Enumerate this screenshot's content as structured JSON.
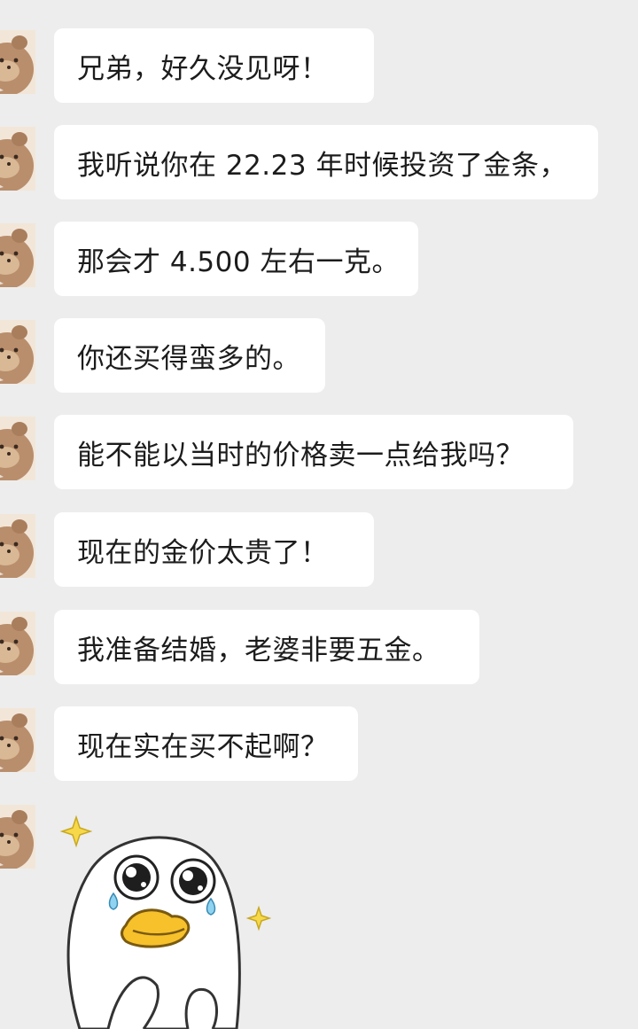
{
  "chat": {
    "messages": [
      {
        "text": "兄弟，好久没见呀！"
      },
      {
        "text": "我听说你在 22.23 年时候投资了金条，"
      },
      {
        "text": "那会才 4.500 左右一克。"
      },
      {
        "text": "你还买得蛮多的。"
      },
      {
        "text": "能不能以当时的价格卖一点给我吗？"
      },
      {
        "text": "现在的金价太贵了！"
      },
      {
        "text": "我准备结婚，老婆非要五金。"
      },
      {
        "text": "现在实在买不起啊？"
      }
    ],
    "sticker": {
      "icon": "crying-duck-sticker-icon"
    },
    "colors": {
      "background": "#ededed",
      "bubble": "#ffffff",
      "text": "#1c1c1c"
    }
  }
}
